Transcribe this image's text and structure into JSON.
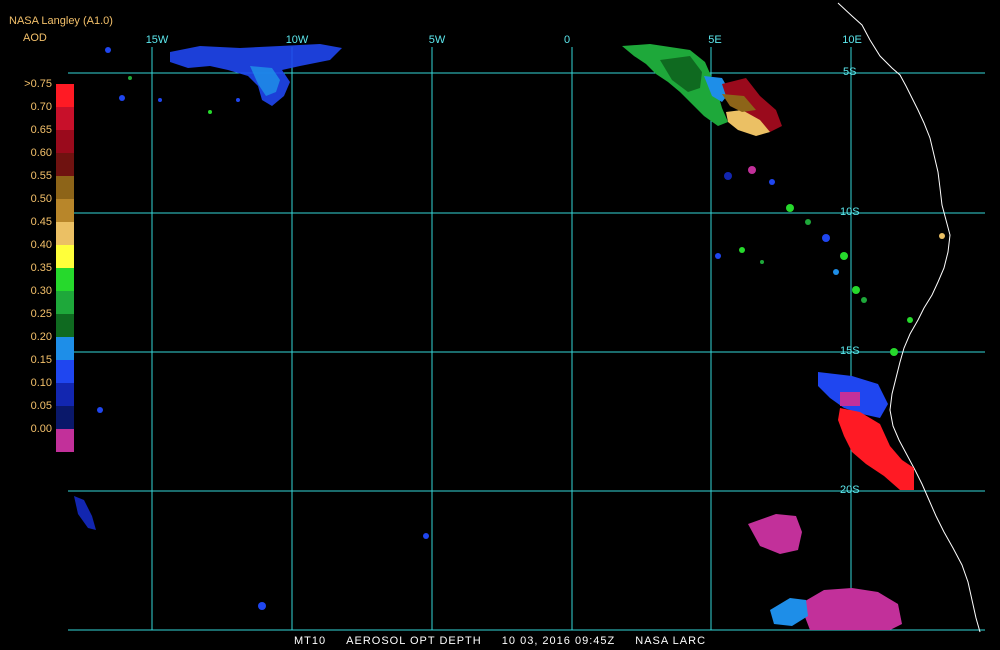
{
  "header": {
    "title": "NASA Langley (A1.0)",
    "product": "AOD"
  },
  "legend": {
    "labels": [
      ">0.75",
      "0.70",
      "0.65",
      "0.60",
      "0.55",
      "0.50",
      "0.45",
      "0.40",
      "0.35",
      "0.30",
      "0.25",
      "0.20",
      "0.15",
      "0.10",
      "0.05",
      "0.00"
    ],
    "colors": [
      "#ff1a24",
      "#c8102a",
      "#9a0a1c",
      "#6f1210",
      "#8d6418",
      "#b8862a",
      "#ebc064",
      "#ffff3a",
      "#26d92c",
      "#1ea83a",
      "#0f6a20",
      "#1e8ee8",
      "#1f46f0",
      "#1226b0",
      "#0a186a",
      "#c2309a"
    ]
  },
  "axes": {
    "longitude_ticks": [
      "15W",
      "10W",
      "5W",
      "0",
      "5E",
      "10E"
    ],
    "latitude_ticks": [
      "5S",
      "10S",
      "15S",
      "20S"
    ]
  },
  "footer": {
    "sensor": "MT10",
    "product": "AEROSOL OPT DEPTH",
    "datetime": "10 03, 2016 09:45Z",
    "source": "NASA LARC"
  },
  "colors": {
    "grid": "#35d6d8",
    "coast": "#ffffff"
  }
}
